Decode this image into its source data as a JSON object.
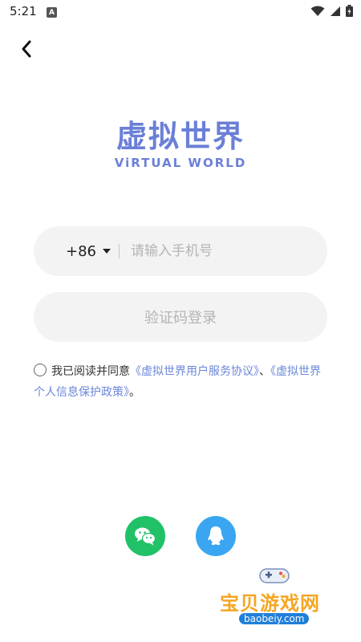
{
  "status_bar": {
    "time": "5:21",
    "badge": "A"
  },
  "logo": {
    "title": "虚拟世界",
    "subtitle": "ViRTUAL WORLD"
  },
  "phone": {
    "country_code": "+86",
    "placeholder": "请输入手机号"
  },
  "login": {
    "label": "验证码登录"
  },
  "agreement": {
    "prefix": "我已阅读并同意",
    "link1": "《虚拟世界用户服务协议》",
    "separator": "、",
    "link2": "《虚拟世界个人信息保护政策》",
    "suffix": "。"
  },
  "watermark": {
    "name": "宝贝游戏网",
    "url": "baobeiy.com"
  },
  "colors": {
    "brand": "#6b7fd7",
    "link": "#6b86d9",
    "wechat": "#21c168",
    "qq": "#3aa6f1"
  },
  "icons": {
    "back": "back-arrow-icon",
    "wechat": "wechat-icon",
    "qq": "qq-icon"
  }
}
